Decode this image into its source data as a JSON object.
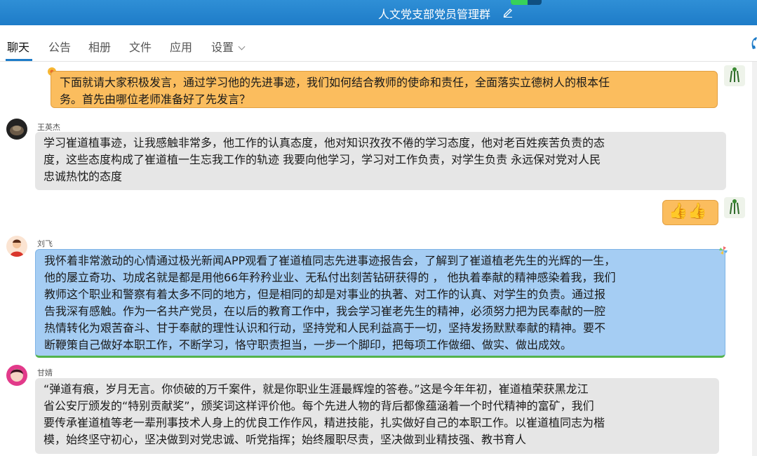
{
  "window": {
    "title": "人文党支部党员管理群"
  },
  "tabs": [
    {
      "label": "聊天"
    },
    {
      "label": "公告"
    },
    {
      "label": "相册"
    },
    {
      "label": "文件"
    },
    {
      "label": "应用"
    },
    {
      "label": "设置"
    }
  ],
  "colors": {
    "accent": "#1e7cc8",
    "orange_bubble": "#fbbd5e",
    "blue_bubble": "#a5cdf3",
    "gray_bubble": "#e6e6e6"
  },
  "messages": [
    {
      "sender": "",
      "side": "right",
      "lines": [
        "下面就请大家积极发言，通过学习他的先进事迹，我们如何结合教师的使命和责任，全面落实立德树人的根本任",
        "务。首先由哪位老师准备好了先发言？"
      ]
    },
    {
      "sender": "王英杰",
      "side": "left",
      "lines": [
        "学习崔道植事迹，让我感触非常多，他工作的认真态度，他对知识孜孜不倦的学习态度，他对老百姓疾苦负责的态",
        "度，这些态度构成了崔道植一生忘我工作的轨迹 我要向他学习，学习对工作负责，对学生负责   永远保对党对人民",
        "忠诚热忱的态度"
      ]
    },
    {
      "sender": "",
      "side": "right",
      "emoji": "👍👍",
      "emoji_name": "thumbs-up-emoji"
    },
    {
      "sender": "刘飞",
      "side": "left",
      "lines": [
        "我怀着非常激动的心情通过极光新闻APP观看了崔道植同志先进事迹报告会，了解到了崔道植老先生的光辉的一生，",
        "他的屡立奇功、功成名就是都是用他66年矜矜业业、无私付出刻苦钻研获得的 ， 他执着奉献的精神感染着我，我们",
        "教师这个职业和警察有着太多不同的地方，但是相同的却是对事业的执著、对工作的认真、对学生的负责。通过报",
        "告我深有感触。作为一名共产党员，在以后的教育工作中，我会学习崔老先生的精神，必须努力把为民奉献的一腔",
        "热情转化为艰苦奋斗、甘于奉献的理性认识和行动，坚持党和人民利益高于一切，坚持发扬默默奉献的精神。要不",
        "断鞭策自己做好本职工作，不断学习，恪守职责担当，一步一个脚印，把每项工作做细、做实、做出成效。"
      ]
    },
    {
      "sender": "甘婧",
      "side": "left",
      "lines": [
        "“弹道有痕，岁月无言。你侦破的万千案件，就是你职业生涯最辉煌的答卷。”这是今年年初，崔道植荣获黑龙江",
        "省公安厅颁发的“特别贡献奖”，颁奖词这样评价他。每个先进人物的背后都像蕴涵着一个时代精神的富矿，我们",
        "要传承崔道植等老一辈刑事技术人身上的优良工作作风，精进技能，扎实做好自己的本职工作。以崔道植同志为楷",
        "模，始终坚守初心，坚决做到对党忠诚、听党指挥；始终履职尽责，坚决做到业精技强、教书育人"
      ]
    }
  ]
}
